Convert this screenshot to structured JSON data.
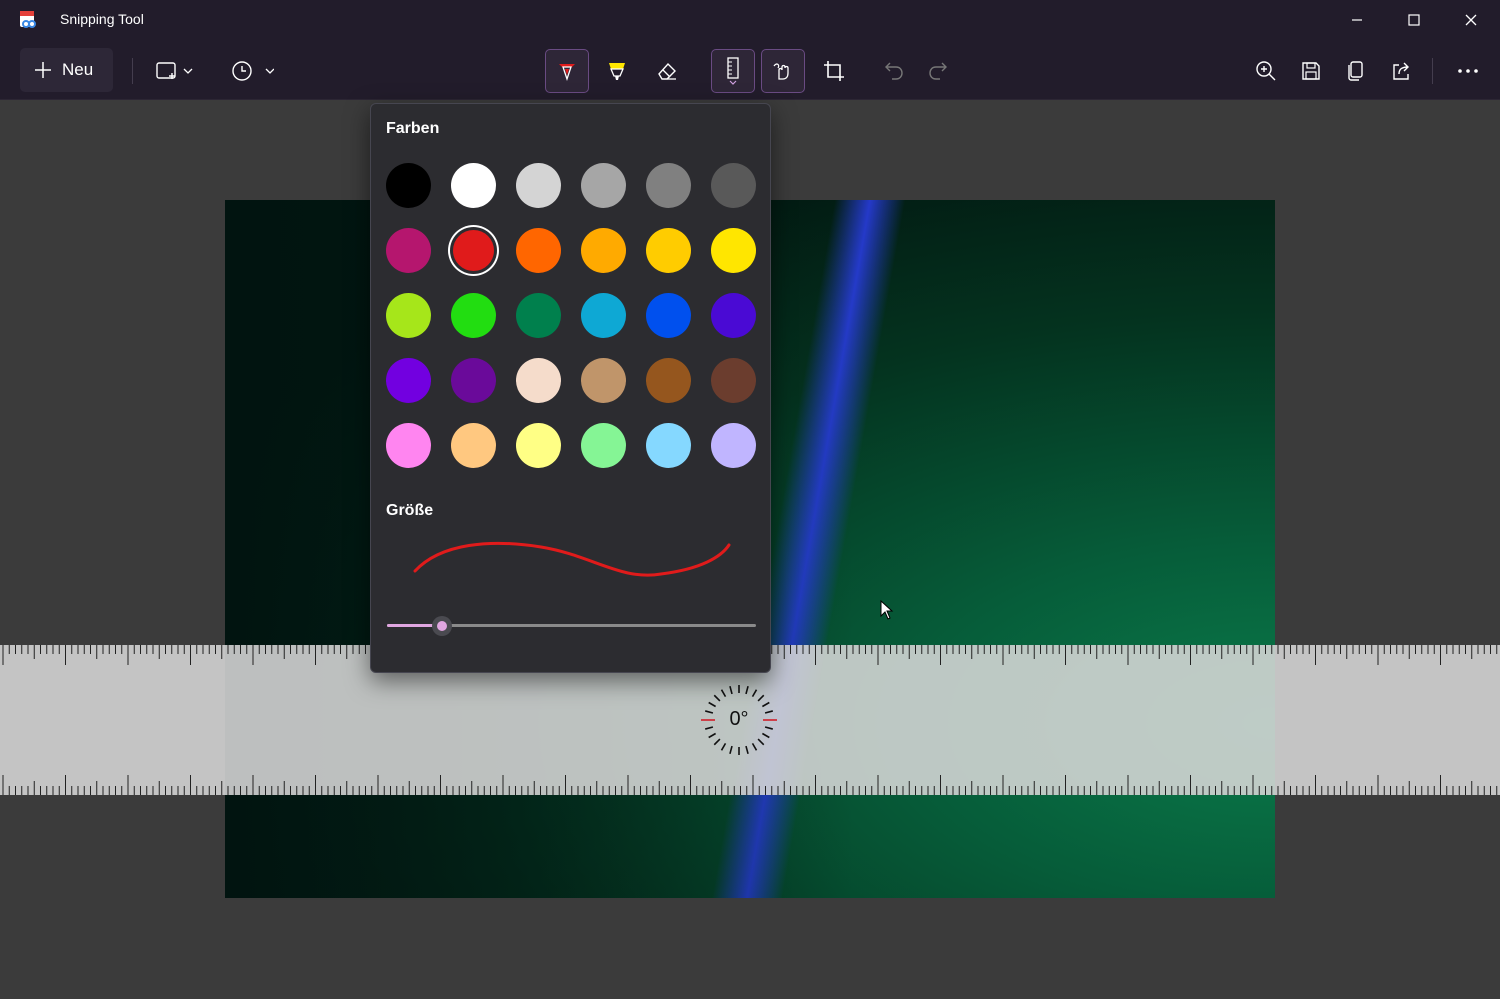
{
  "window": {
    "title": "Snipping Tool"
  },
  "toolbar": {
    "new_label": "Neu",
    "buttons": [
      "snip-mode",
      "delay",
      "ballpoint-pen",
      "highlighter",
      "eraser",
      "ruler",
      "touch-writing",
      "crop",
      "undo",
      "redo",
      "zoom",
      "save",
      "copy",
      "share",
      "more"
    ]
  },
  "popup": {
    "colors_heading": "Farben",
    "size_heading": "Größe",
    "colors": [
      "#000000",
      "#ffffff",
      "#d4d4d4",
      "#a6a6a6",
      "#808080",
      "#595959",
      "#b5166e",
      "#e01b1b",
      "#ff6600",
      "#ffaa00",
      "#ffcc00",
      "#ffe600",
      "#a6e61a",
      "#22dd11",
      "#00804d",
      "#0ea8d4",
      "#0050ee",
      "#4a0ad4",
      "#7200e0",
      "#6a0a9a",
      "#f5dccb",
      "#c0956a",
      "#95561e",
      "#6b3d2e",
      "#ff85f0",
      "#ffc880",
      "#ffff85",
      "#85f595",
      "#85d8ff",
      "#c0b5ff"
    ],
    "selected_color": "#e01b1b",
    "size_value_fraction": 0.15
  },
  "ruler": {
    "angle": "0°"
  },
  "accent": "#b35ab8"
}
